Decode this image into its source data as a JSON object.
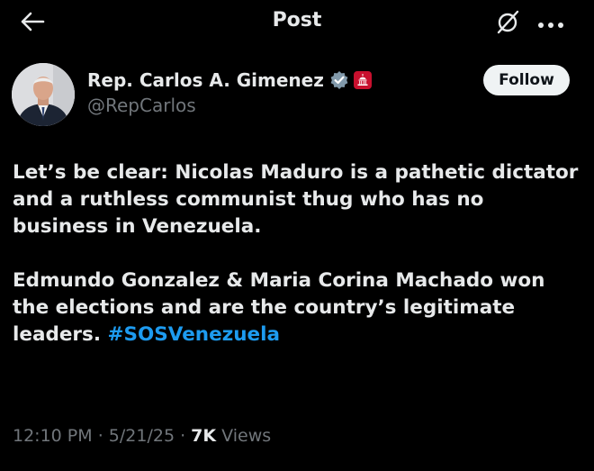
{
  "header": {
    "title": "Post",
    "back_icon": "arrow-left-icon",
    "grok_icon": "grok-slash-circle-icon",
    "more_icon": "more-dots-icon"
  },
  "author": {
    "name": "Rep. Carlos A. Gimenez",
    "handle": "@RepCarlos",
    "verified_icon": "verified-badge-icon",
    "verified_color": "#829aab",
    "affiliation_icon": "us-capitol-badge-icon",
    "affiliation_color": "#c8102e"
  },
  "follow_button": {
    "label": "Follow"
  },
  "post": {
    "paragraph1": "Let’s be clear: Nicolas Maduro is a pathetic dictator and a ruthless communist thug who has no business in Venezuela.",
    "paragraph2": "Edmundo Gonzalez & Maria Corina Machado won the elections and are the country’s legitimate leaders.",
    "hashtag": "#SOSVenezuela",
    "hashtag_color": "#1d9bf0"
  },
  "meta": {
    "time": "12:10 PM",
    "separator1": " · ",
    "date": "5/21/25",
    "separator2": " · ",
    "views_count": "7K",
    "views_label": " Views"
  },
  "colors": {
    "background": "#000000",
    "text_primary": "#e7e9ea",
    "text_secondary": "#71767b"
  }
}
